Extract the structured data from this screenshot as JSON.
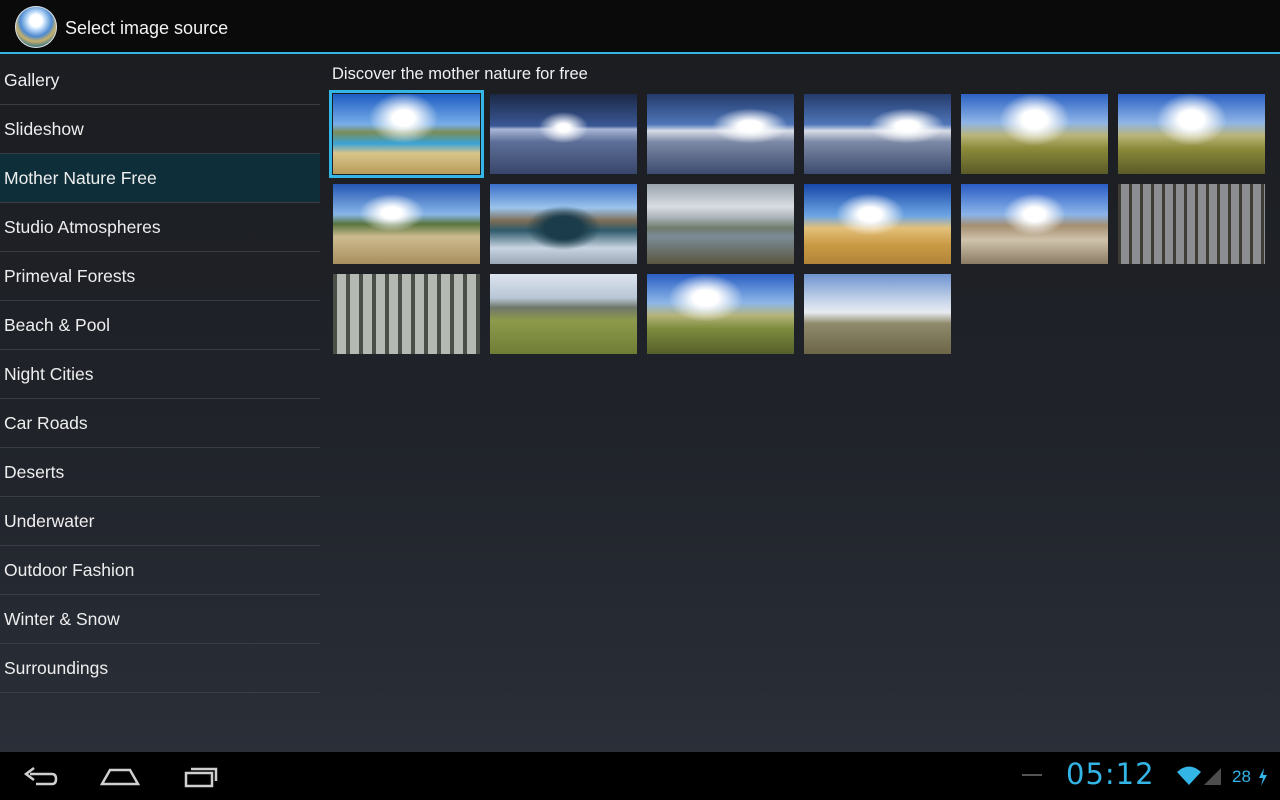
{
  "window": {
    "title": "Select image source",
    "app_icon": "panorama-sphere-icon"
  },
  "sidebar": {
    "selected_index": 2,
    "items": [
      {
        "label": "Gallery"
      },
      {
        "label": "Slideshow"
      },
      {
        "label": "Mother Nature Free"
      },
      {
        "label": "Studio Atmospheres"
      },
      {
        "label": "Primeval Forests"
      },
      {
        "label": "Beach & Pool"
      },
      {
        "label": "Night Cities"
      },
      {
        "label": "Car Roads"
      },
      {
        "label": "Deserts"
      },
      {
        "label": "Underwater"
      },
      {
        "label": "Outdoor Fashion"
      },
      {
        "label": "Winter & Snow"
      },
      {
        "label": "Surroundings"
      }
    ]
  },
  "content": {
    "heading": "Discover the mother nature for free",
    "thumbnails": [
      {
        "scene": "beach-pool"
      },
      {
        "scene": "snow-night"
      },
      {
        "scene": "snow-field"
      },
      {
        "scene": "snow-field"
      },
      {
        "scene": "grass-hill"
      },
      {
        "scene": "grass-hill"
      },
      {
        "scene": "rocky-shore"
      },
      {
        "scene": "lake-cliffs"
      },
      {
        "scene": "coast-cliff"
      },
      {
        "scene": "sand-dune"
      },
      {
        "scene": "rocky-desert"
      },
      {
        "scene": "forest"
      },
      {
        "scene": "forest-pale"
      },
      {
        "scene": "meadow"
      },
      {
        "scene": "green-hills"
      },
      {
        "scene": "snow-meadow"
      }
    ]
  },
  "status_bar": {
    "time": "05:12",
    "battery": "28",
    "icons": [
      "back-icon",
      "home-icon",
      "recent-apps-icon",
      "wifi-icon",
      "signal-icon",
      "battery-icon"
    ]
  },
  "colors": {
    "accent": "#33b5e5",
    "selected_row": "#0e2f3a"
  }
}
